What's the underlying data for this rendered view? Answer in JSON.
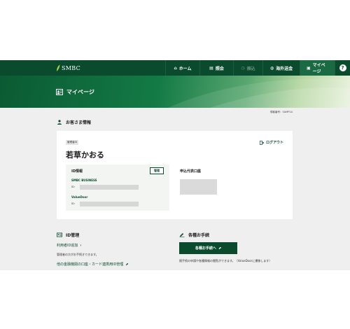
{
  "brand": {
    "name": "SMBC",
    "color": "#0a4a2d",
    "mark_color": "#a8d44a"
  },
  "nav": {
    "items": [
      {
        "icon": "home-icon",
        "glyph": "⌂",
        "label": "ホーム",
        "state": "normal"
      },
      {
        "icon": "book-icon",
        "glyph": "▤",
        "label": "照会",
        "state": "normal"
      },
      {
        "icon": "clock-icon",
        "glyph": "◷",
        "label": "振込",
        "state": "disabled"
      },
      {
        "icon": "globe-icon",
        "glyph": "◍",
        "label": "海外送金",
        "state": "normal"
      },
      {
        "icon": "person-card-icon",
        "glyph": "▣",
        "label": "マイページ",
        "state": "active"
      }
    ],
    "help_glyph": "?"
  },
  "hero": {
    "title": "マイページ"
  },
  "member_number": "御客番号：SAMP1A",
  "customer_info": {
    "section_title": "お客さま情報",
    "role_badge": "管理者ID",
    "user_name": "若草かおる",
    "logout_label": "ログアウト",
    "id_info": {
      "heading": "ID情報",
      "manage_label": "管理",
      "services": [
        {
          "name": "SMBC BUSINESS",
          "id_label": "ID："
        },
        {
          "name": "ValueDoor",
          "id_label": "ID："
        }
      ]
    },
    "contact": {
      "heading": "申込代表口座"
    }
  },
  "id_management": {
    "section_title": "ID管理",
    "add_user_link": "利用者ID追加",
    "add_user_chevron": "›",
    "note": "管理者の方がお手続きできます。",
    "other_link": "他の金融機関の口座・カード連携用ID管理",
    "external_glyph": "⬈"
  },
  "procedures": {
    "section_title": "各種お手続",
    "button_label": "各種お手続へ",
    "external_glyph": "⬈",
    "note": "随手続の申請や各種情報の閲覧ができます。（ValueDoorに遷移します）"
  }
}
